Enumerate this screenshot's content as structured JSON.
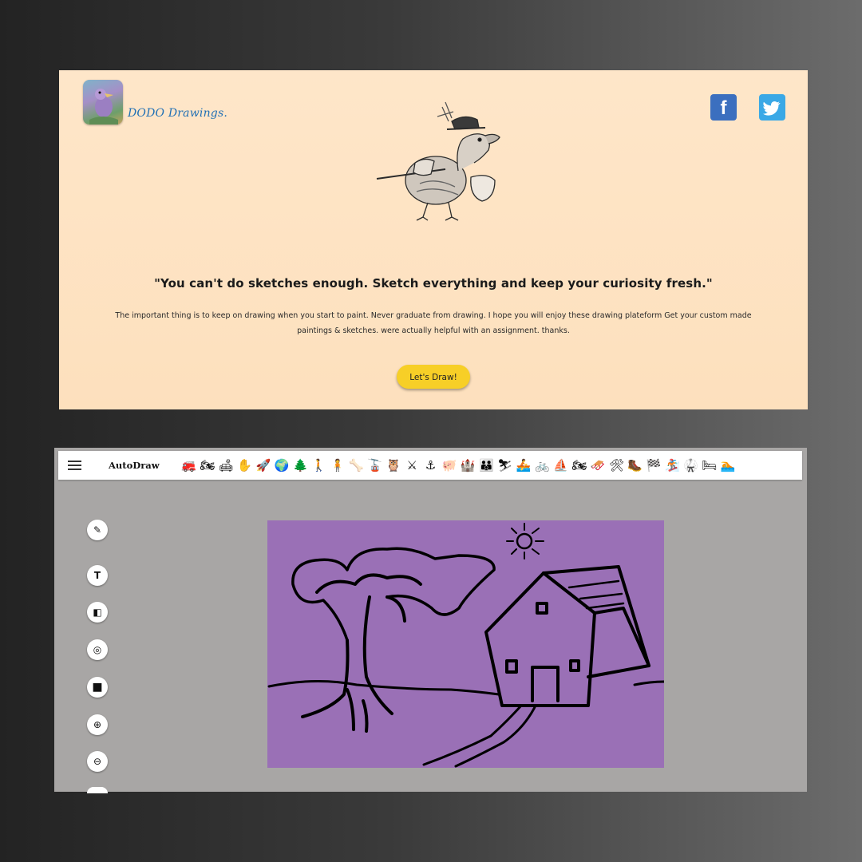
{
  "landing": {
    "brand_name": "DODO Drawings.",
    "quote": "\"You can't do sketches enough. Sketch everything and keep your curiosity fresh.\"",
    "description": "The important thing is to keep on drawing when you start to paint. Never graduate from drawing. I hope you will enjoy these drawing plateform Get your custom made paintings & sketches. were actually helpful with an assignment. thanks.",
    "cta_label": "Let's Draw!",
    "social": {
      "facebook_glyph": "f",
      "twitter_glyph": "🐦"
    },
    "colors": {
      "background": "#fde3c4",
      "button": "#f7cf27",
      "brand_text": "#1f6fb5",
      "facebook": "#3b6fbf",
      "twitter": "#3aa8e6"
    }
  },
  "editor": {
    "app_title": "AutoDraw",
    "menu_icon": "hamburger-icon",
    "categories": [
      {
        "icon": "firetruck-icon",
        "glyph": "🚒"
      },
      {
        "icon": "motorcycle-icon",
        "glyph": "🏍"
      },
      {
        "icon": "couch-icon",
        "glyph": "🛋"
      },
      {
        "icon": "hand-icon",
        "glyph": "✋"
      },
      {
        "icon": "rocket-icon",
        "glyph": "🚀"
      },
      {
        "icon": "globe-icon",
        "glyph": "🌍"
      },
      {
        "icon": "trees-icon",
        "glyph": "🌲"
      },
      {
        "icon": "walking-person-icon",
        "glyph": "🚶"
      },
      {
        "icon": "person-icon",
        "glyph": "🧍"
      },
      {
        "icon": "bone-icon",
        "glyph": "🦴"
      },
      {
        "icon": "cable-car-icon",
        "glyph": "🚡"
      },
      {
        "icon": "owl-icon",
        "glyph": "🦉"
      },
      {
        "icon": "crossed-swords-icon",
        "glyph": "⚔"
      },
      {
        "icon": "anchor-icon",
        "glyph": "⚓"
      },
      {
        "icon": "piggy-bank-icon",
        "glyph": "🐖"
      },
      {
        "icon": "castle-icon",
        "glyph": "🏰"
      },
      {
        "icon": "family-icon",
        "glyph": "👪"
      },
      {
        "icon": "skier-icon",
        "glyph": "⛷"
      },
      {
        "icon": "rowing-icon",
        "glyph": "🚣"
      },
      {
        "icon": "bicycle-icon",
        "glyph": "🚲"
      },
      {
        "icon": "sailboat-icon",
        "glyph": "⛵"
      },
      {
        "icon": "atv-icon",
        "glyph": "🏍"
      },
      {
        "icon": "snowmobile-icon",
        "glyph": "🛷"
      },
      {
        "icon": "tools-icon",
        "glyph": "🛠"
      },
      {
        "icon": "hiker-icon",
        "glyph": "🥾"
      },
      {
        "icon": "flag-icon",
        "glyph": "🏁"
      },
      {
        "icon": "snowboarder-icon",
        "glyph": "🏂"
      },
      {
        "icon": "karate-icon",
        "glyph": "🥋"
      },
      {
        "icon": "bed-icon",
        "glyph": "🛏"
      },
      {
        "icon": "swimmer-icon",
        "glyph": "🏊"
      }
    ],
    "tools": [
      {
        "icon": "autodraw-pen-icon",
        "glyph": "✎"
      },
      {
        "icon": "text-tool-icon",
        "glyph": "T"
      },
      {
        "icon": "fill-bucket-icon",
        "glyph": "◧"
      },
      {
        "icon": "shapes-icon",
        "glyph": "◎"
      },
      {
        "icon": "color-swatch-icon",
        "glyph": "■"
      },
      {
        "icon": "zoom-in-icon",
        "glyph": "⊕"
      },
      {
        "icon": "zoom-out-icon",
        "glyph": "⊖"
      }
    ],
    "colors": {
      "workspace": "#a8a6a5",
      "canvas": "#9a70b6",
      "stroke": "#000000"
    }
  }
}
